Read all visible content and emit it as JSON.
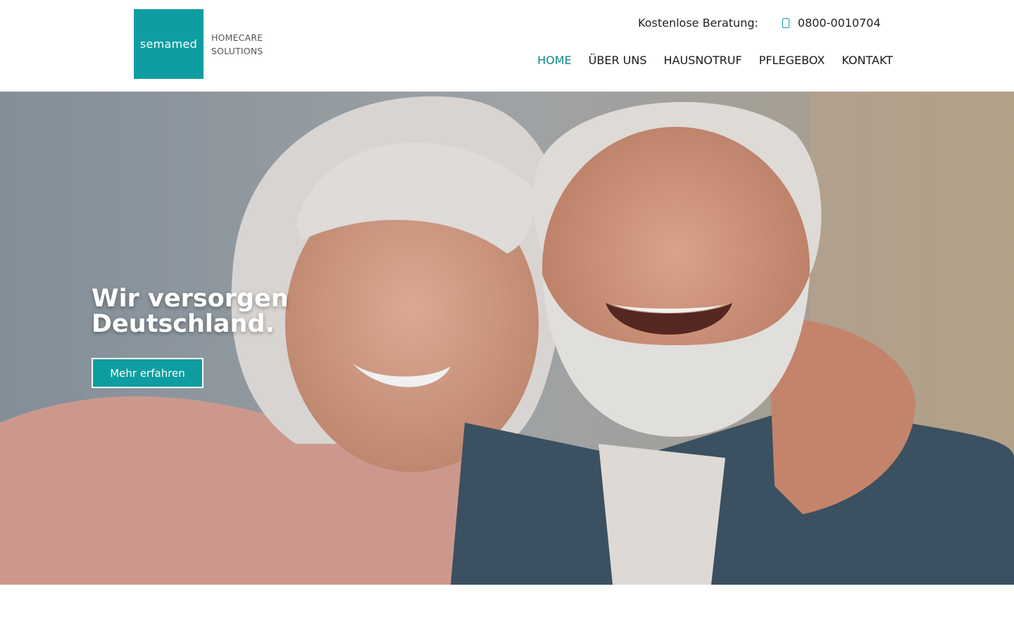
{
  "header": {
    "logo": {
      "brand": "semamed",
      "line1": "HOMECARE",
      "line2": "SOLUTIONS"
    },
    "contact": {
      "label": "Kostenlose Beratung:",
      "phone": "0800-0010704",
      "icon": "phone-icon"
    },
    "nav": [
      {
        "label": "HOME",
        "active": true
      },
      {
        "label": "ÜBER UNS",
        "active": false
      },
      {
        "label": "HAUSNOTRUF",
        "active": false
      },
      {
        "label": "PFLEGEBOX",
        "active": false
      },
      {
        "label": "KONTAKT",
        "active": false
      }
    ]
  },
  "hero": {
    "title": "Wir versorgen Deutschland.",
    "button_label": "Mehr erfahren"
  },
  "colors": {
    "accent": "#0e9ea1",
    "nav_active": "#0e8a8d",
    "text": "#1a1a1a"
  }
}
